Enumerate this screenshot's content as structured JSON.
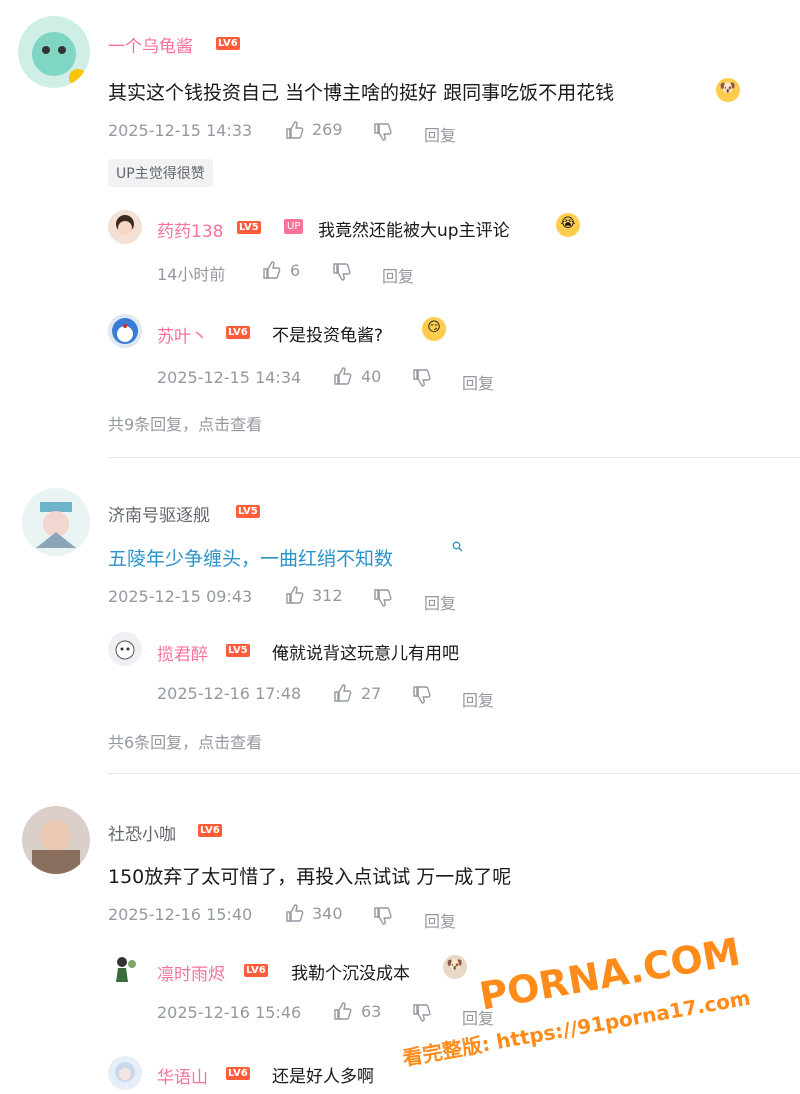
{
  "comments": [
    {
      "user": "一个乌龟酱",
      "level": "LV6",
      "text": "其实这个钱投资自己 当个博主啥的挺好 跟同事吃饭不用花钱",
      "time": "2025-12-15 14:33",
      "likes": "269",
      "reply_label": "回复",
      "badge": "UP主觉得很赞",
      "replies": [
        {
          "user": "药药138",
          "level": "LV5",
          "up_tag": "UP",
          "text": "我竟然还能被大up主评论",
          "time": "14小时前",
          "likes": "6",
          "reply_label": "回复"
        },
        {
          "user": "苏叶丶",
          "level": "LV6",
          "text": "不是投资龟酱?",
          "time": "2025-12-15 14:34",
          "likes": "40",
          "reply_label": "回复"
        }
      ],
      "more": "共9条回复，点击查看"
    },
    {
      "user": "济南号驱逐舰",
      "level": "LV5",
      "text": "五陵年少争缠头，一曲红绡不知数",
      "time": "2025-12-15 09:43",
      "likes": "312",
      "reply_label": "回复",
      "replies": [
        {
          "user": "揽君醉",
          "level": "LV5",
          "text": "俺就说背这玩意儿有用吧",
          "time": "2025-12-16 17:48",
          "likes": "27",
          "reply_label": "回复"
        }
      ],
      "more": "共6条回复，点击查看"
    },
    {
      "user": "社恐小咖",
      "level": "LV6",
      "text": "150放弃了太可惜了，再投入点试试 万一成了呢",
      "time": "2025-12-16 15:40",
      "likes": "340",
      "reply_label": "回复",
      "replies": [
        {
          "user": "凛时雨烬",
          "level": "LV6",
          "text": "我勒个沉没成本",
          "time": "2025-12-16 15:46",
          "likes": "63",
          "reply_label": "回复"
        },
        {
          "user": "华语山",
          "level": "LV6",
          "text": "还是好人多啊"
        }
      ]
    }
  ],
  "watermark": {
    "line1": "PORNA.COM",
    "line2": "看完整版: https://91porna17.com"
  },
  "colors": {
    "accent_pink": "#fb7299",
    "level_badge": "#ff5c3a",
    "meta_gray": "#9499a0",
    "highlight_blue": "#2a93c9",
    "watermark": "#ff8c1a"
  }
}
